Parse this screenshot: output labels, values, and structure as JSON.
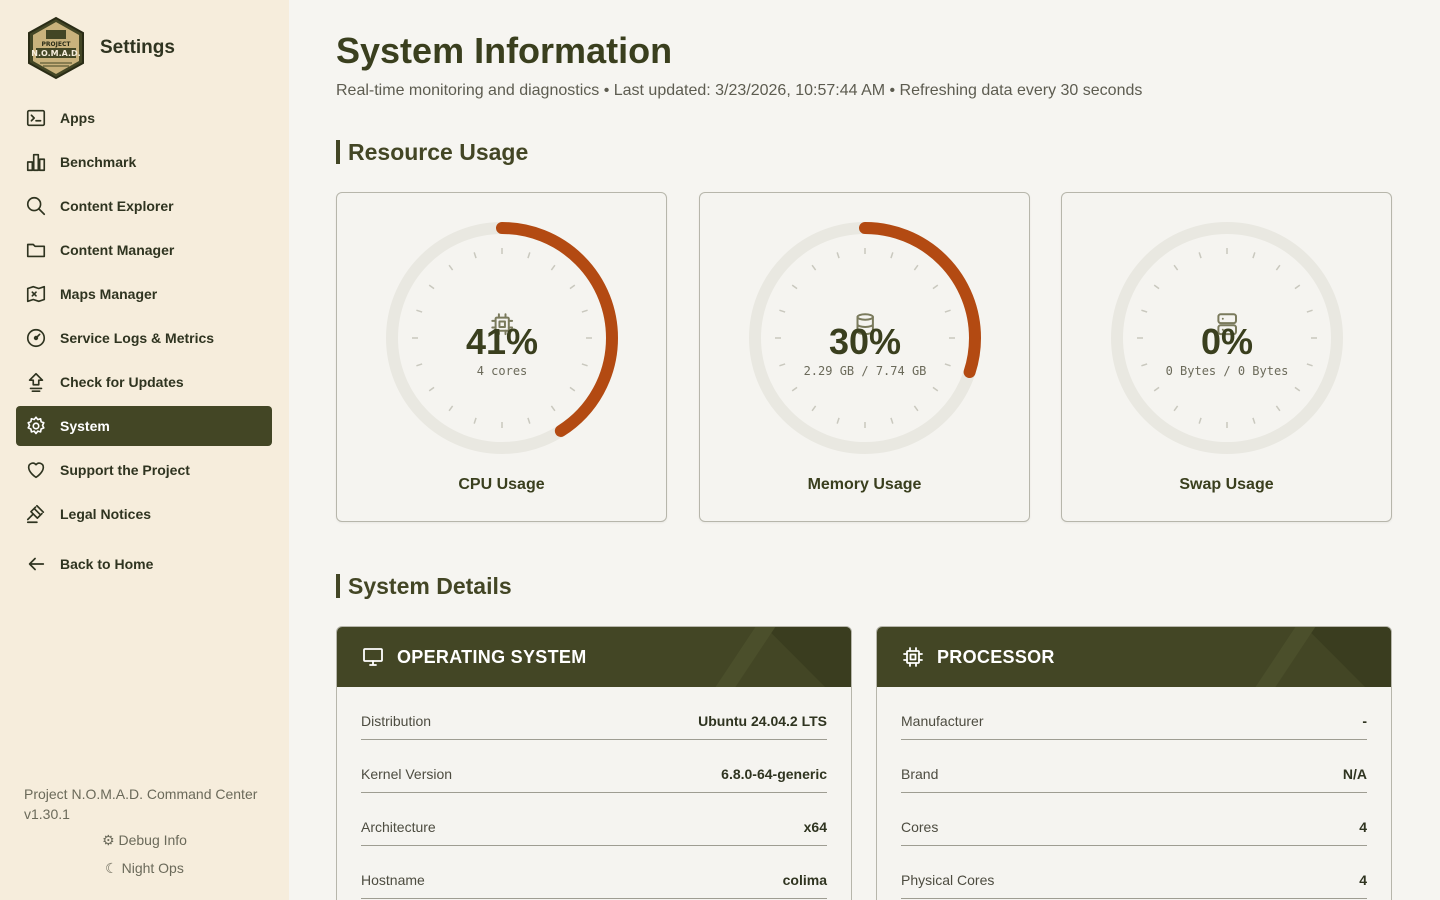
{
  "sidebar": {
    "title": "Settings",
    "logo_text": [
      "PROJECT",
      "N.O.M.A.D."
    ],
    "items": [
      {
        "label": "Apps",
        "icon": "terminal-icon",
        "active": false
      },
      {
        "label": "Benchmark",
        "icon": "bar-chart-icon",
        "active": false
      },
      {
        "label": "Content Explorer",
        "icon": "search-icon",
        "active": false
      },
      {
        "label": "Content Manager",
        "icon": "folder-icon",
        "active": false
      },
      {
        "label": "Maps Manager",
        "icon": "map-icon",
        "active": false
      },
      {
        "label": "Service Logs & Metrics",
        "icon": "gauge-icon",
        "active": false
      },
      {
        "label": "Check for Updates",
        "icon": "update-arrow-icon",
        "active": false
      },
      {
        "label": "System",
        "icon": "gear-icon",
        "active": true
      },
      {
        "label": "Support the Project",
        "icon": "heart-icon",
        "active": false
      },
      {
        "label": "Legal Notices",
        "icon": "gavel-icon",
        "active": false
      }
    ],
    "back_label": "Back to Home",
    "footer_version": "Project N.O.M.A.D. Command Center v1.30.1",
    "debug_label": "Debug Info",
    "night_label": "Night Ops"
  },
  "header": {
    "title": "System Information",
    "subtitle": "Real-time monitoring and diagnostics • Last updated: 3/23/2026, 10:57:44 AM • Refreshing data every 30 seconds"
  },
  "resource_usage": {
    "title": "Resource Usage",
    "gauges": [
      {
        "label": "CPU Usage",
        "percent": 41,
        "value": "41%",
        "detail": "4 cores",
        "icon": "cpu-icon"
      },
      {
        "label": "Memory Usage",
        "percent": 30,
        "value": "30%",
        "detail": "2.29 GB / 7.74 GB",
        "icon": "database-icon"
      },
      {
        "label": "Swap Usage",
        "percent": 0,
        "value": "0%",
        "detail": "0 Bytes / 0 Bytes",
        "icon": "server-icon"
      }
    ]
  },
  "system_details": {
    "title": "System Details",
    "os": {
      "title": "OPERATING SYSTEM",
      "rows": [
        {
          "key": "Distribution",
          "value": "Ubuntu 24.04.2 LTS"
        },
        {
          "key": "Kernel Version",
          "value": "6.8.0-64-generic"
        },
        {
          "key": "Architecture",
          "value": "x64"
        },
        {
          "key": "Hostname",
          "value": "colima"
        }
      ]
    },
    "processor": {
      "title": "PROCESSOR",
      "rows": [
        {
          "key": "Manufacturer",
          "value": "-"
        },
        {
          "key": "Brand",
          "value": "N/A"
        },
        {
          "key": "Cores",
          "value": "4"
        },
        {
          "key": "Physical Cores",
          "value": "4"
        }
      ]
    }
  },
  "colors": {
    "accent": "#434625",
    "gauge_fill": "#b34a12",
    "gauge_track": "#e9e8e1"
  }
}
